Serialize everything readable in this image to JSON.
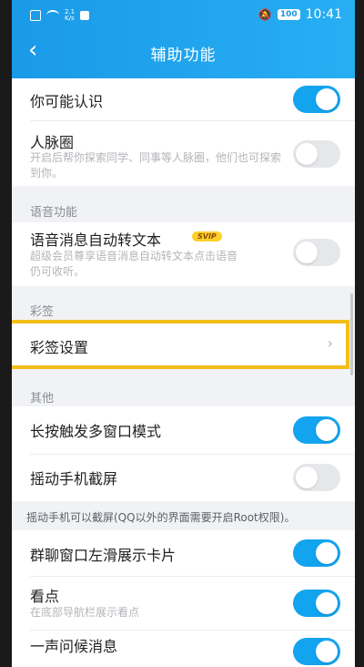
{
  "status_bar": {
    "speed_value": "2.1",
    "speed_unit": "K/s",
    "battery": "100",
    "time": "10:41"
  },
  "header": {
    "title": "辅助功能"
  },
  "sections": {
    "voice": "语音功能",
    "caiqian": "彩签",
    "other": "其他"
  },
  "rows": {
    "may_know": {
      "title": "你可能认识",
      "enabled": true
    },
    "network": {
      "title": "人脉圈",
      "subtitle": "开启后帮你探索同学、同事等人脉圈，他们也可探索到你。",
      "enabled": false
    },
    "voice_to_text": {
      "title": "语音消息自动转文本",
      "badge": "SVIP",
      "subtitle": "超级会员尊享语音消息自动转文本点击语音仍可收听。",
      "enabled": false
    },
    "caiqian_settings": {
      "title": "彩签设置"
    },
    "multiwindow": {
      "title": "长按触发多窗口模式",
      "enabled": true
    },
    "shake_screenshot": {
      "title": "摇动手机截屏",
      "enabled": false
    },
    "group_card": {
      "title": "群聊窗口左滑展示卡片",
      "enabled": true
    },
    "kandian": {
      "title": "看点",
      "subtitle": "在底部导航栏展示看点",
      "enabled": true
    },
    "greeting": {
      "title": "一声问候消息",
      "enabled": true
    }
  },
  "notes": {
    "shake": "摇动手机可以截屏(QQ以外的界面需要开启Root权限)。"
  },
  "colors": {
    "header": "#1a9ae7",
    "toggle_on": "#13a4ef",
    "highlight": "#f4be18"
  }
}
